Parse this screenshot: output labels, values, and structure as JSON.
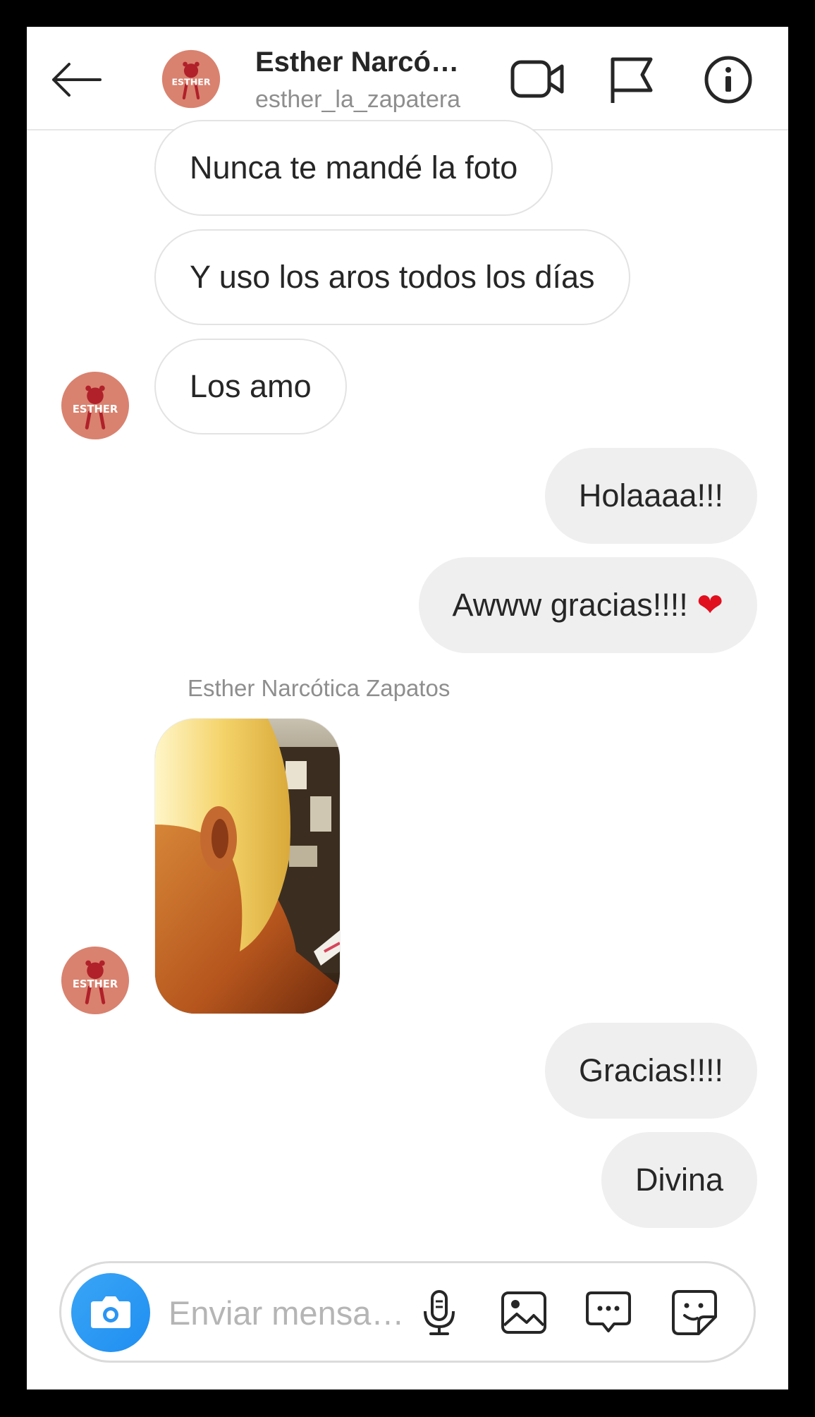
{
  "header": {
    "contact_name": "Esther Narcó…",
    "username": "esther_la_zapatera",
    "avatar_text": "ESTHER",
    "icons": [
      "back-arrow-icon",
      "video-call-icon",
      "flag-icon",
      "info-icon"
    ]
  },
  "messages": [
    {
      "side": "incoming",
      "text": "Nunca te mandé la foto"
    },
    {
      "side": "incoming",
      "text": "Y uso los aros todos los días"
    },
    {
      "side": "incoming",
      "text": "Los amo"
    },
    {
      "side": "outgoing",
      "text": "Holaaaa!!!"
    },
    {
      "side": "outgoing",
      "text": "Awww gracias!!!! ❤️"
    },
    {
      "side": "incoming",
      "sender": "Esther Narcótica Zapatos",
      "type": "photo"
    },
    {
      "side": "outgoing",
      "text": "Gracias!!!!"
    },
    {
      "side": "outgoing",
      "text": "Divina"
    }
  ],
  "composer": {
    "placeholder": "Enviar mensa…",
    "icons": [
      "camera-icon",
      "microphone-icon",
      "gallery-icon",
      "quick-reply-icon",
      "sticker-icon"
    ]
  },
  "colors": {
    "accent_blue": "#3897f0",
    "outgoing_bubble": "#efefef",
    "avatar_bg": "#d9826f",
    "avatar_fg": "#b0212a",
    "heart": "#e0101f"
  }
}
